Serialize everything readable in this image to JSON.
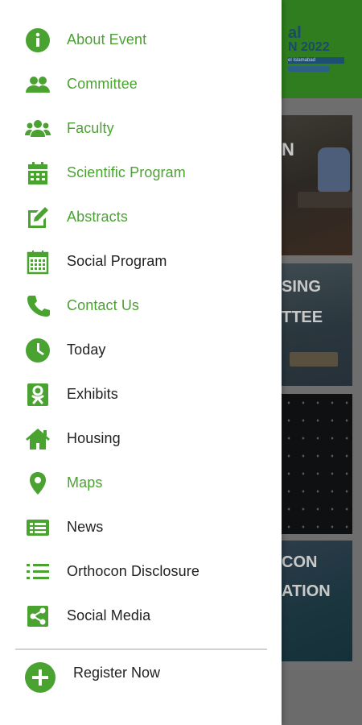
{
  "colors": {
    "accent": "#4aa331",
    "text": "#222222",
    "drawer_bg": "#ffffff",
    "scrim": "#6e6e6e"
  },
  "background": {
    "header_line1": "al",
    "header_line2": "N 2022",
    "header_line3": "el Islamabad",
    "tiles": [
      {
        "text": "N"
      },
      {
        "text_line1": "SING",
        "text_line2": "TTEE"
      },
      {
        "text": ""
      },
      {
        "text_line1": "CON",
        "text_line2": "ATION"
      }
    ]
  },
  "menu": {
    "items": [
      {
        "label": "About Event",
        "icon": "info-circle-icon",
        "highlight": true
      },
      {
        "label": "Committee",
        "icon": "users-icon",
        "highlight": true
      },
      {
        "label": "Faculty",
        "icon": "group-icon",
        "highlight": true
      },
      {
        "label": "Scientific Program",
        "icon": "calendar-icon",
        "highlight": true
      },
      {
        "label": "Abstracts",
        "icon": "edit-icon",
        "highlight": true
      },
      {
        "label": "Social Program",
        "icon": "calendar-grid-icon",
        "highlight": false
      },
      {
        "label": "Contact Us",
        "icon": "phone-icon",
        "highlight": true
      },
      {
        "label": "Today",
        "icon": "clock-icon",
        "highlight": false
      },
      {
        "label": "Exhibits",
        "icon": "odnoklassniki-icon",
        "highlight": false
      },
      {
        "label": "Housing",
        "icon": "home-icon",
        "highlight": false
      },
      {
        "label": "Maps",
        "icon": "map-pin-icon",
        "highlight": true
      },
      {
        "label": "News",
        "icon": "news-icon",
        "highlight": false
      },
      {
        "label": "Orthocon Disclosure",
        "icon": "list-icon",
        "highlight": false
      },
      {
        "label": "Social Media",
        "icon": "share-icon",
        "highlight": false
      }
    ]
  },
  "register": {
    "label": "Register Now",
    "icon": "plus-circle-icon"
  }
}
